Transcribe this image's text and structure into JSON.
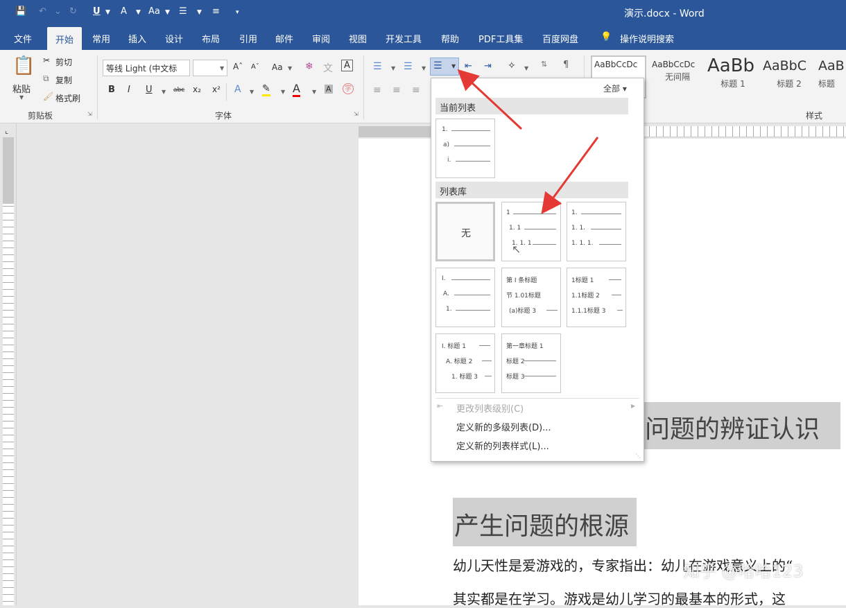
{
  "titlebar": {
    "title": "演示.docx  -  Word"
  },
  "tabs": [
    {
      "label": "文件"
    },
    {
      "label": "开始"
    },
    {
      "label": "常用"
    },
    {
      "label": "插入"
    },
    {
      "label": "设计"
    },
    {
      "label": "布局"
    },
    {
      "label": "引用"
    },
    {
      "label": "邮件"
    },
    {
      "label": "审阅"
    },
    {
      "label": "视图"
    },
    {
      "label": "开发工具"
    },
    {
      "label": "帮助"
    },
    {
      "label": "PDF工具集"
    },
    {
      "label": "百度网盘"
    },
    {
      "label": "操作说明搜索"
    }
  ],
  "clipboard": {
    "paste": "粘贴",
    "cut": "剪切",
    "copy": "复制",
    "format_painter": "格式刷",
    "group": "剪贴板"
  },
  "font": {
    "name": "等线 Light (中文标",
    "size": "",
    "group": "字体",
    "aa": "Aa",
    "bold": "B",
    "italic": "I",
    "underline": "U",
    "strike": "abc",
    "sub": "x₂",
    "sup": "x²"
  },
  "styles": {
    "show_all": "全部",
    "group": "样式",
    "items": [
      {
        "preview": "AaBbCcDc",
        "name": ""
      },
      {
        "preview": "AaBbCcDc",
        "name": "无间隔"
      },
      {
        "preview": "AaBb",
        "name": "标题 1"
      },
      {
        "preview": "AaBbC",
        "name": "标题 2"
      },
      {
        "preview": "AaB",
        "name": "标题"
      }
    ]
  },
  "dropdown": {
    "current_list_header": "当前列表",
    "library_header": "列表库",
    "current_list": [
      "1.",
      "a)",
      "i."
    ],
    "none_label": "无",
    "tiles": [
      {
        "lines": [
          "1",
          "1. 1",
          "1. 1. 1"
        ]
      },
      {
        "lines": [
          "1.",
          "1. 1.",
          "1. 1. 1."
        ]
      },
      {
        "lines": [
          "I.",
          "A.",
          "1."
        ]
      },
      {
        "lines": [
          "第 I 条标题",
          "节 1.01标题",
          "(a)标题 3"
        ]
      },
      {
        "lines": [
          "1标题 1",
          "1.1标题 2",
          "1.1.1标题 3"
        ]
      },
      {
        "lines": [
          "I. 标题 1",
          "A. 标题 2",
          "1. 标题 3"
        ]
      },
      {
        "lines": [
          "第一章标题 1",
          "标题 2",
          "标题 3"
        ]
      }
    ],
    "menu": {
      "change_level": "更改列表级别(C)",
      "define_multilevel": "定义新的多级列表(D)...",
      "define_style": "定义新的列表样式(L)..."
    }
  },
  "document": {
    "heading1": "问题的辨证认识",
    "heading2": "产生问题的根源",
    "line1": "幼儿天性是爱游戏的，专家指出：幼儿在游戏意义上的“",
    "line2": "其实都是在学习。游戏是幼儿学习的最基本的形式，这"
  },
  "watermark": "知乎 @哈哈123",
  "colors": {
    "accent": "#2b579a",
    "arrow": "#e53935"
  }
}
